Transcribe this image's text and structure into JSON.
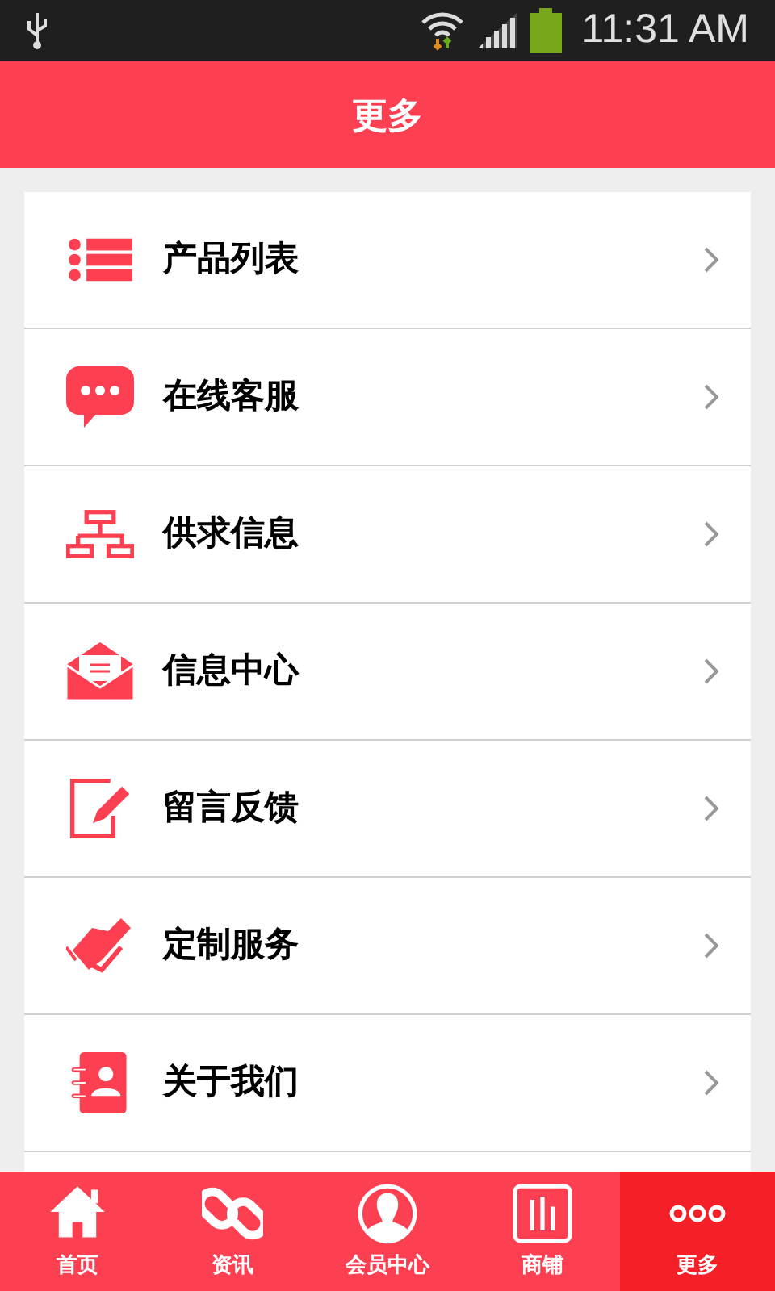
{
  "status_bar": {
    "time": "11:31 AM"
  },
  "header": {
    "title": "更多"
  },
  "menu": [
    {
      "label": "产品列表"
    },
    {
      "label": "在线客服"
    },
    {
      "label": "供求信息"
    },
    {
      "label": "信息中心"
    },
    {
      "label": "留言反馈"
    },
    {
      "label": "定制服务"
    },
    {
      "label": "关于我们"
    }
  ],
  "tab_bar": [
    {
      "label": "首页",
      "selected": false
    },
    {
      "label": "资讯",
      "selected": false
    },
    {
      "label": "会员中心",
      "selected": false
    },
    {
      "label": "商铺",
      "selected": false
    },
    {
      "label": "更多",
      "selected": true
    }
  ]
}
